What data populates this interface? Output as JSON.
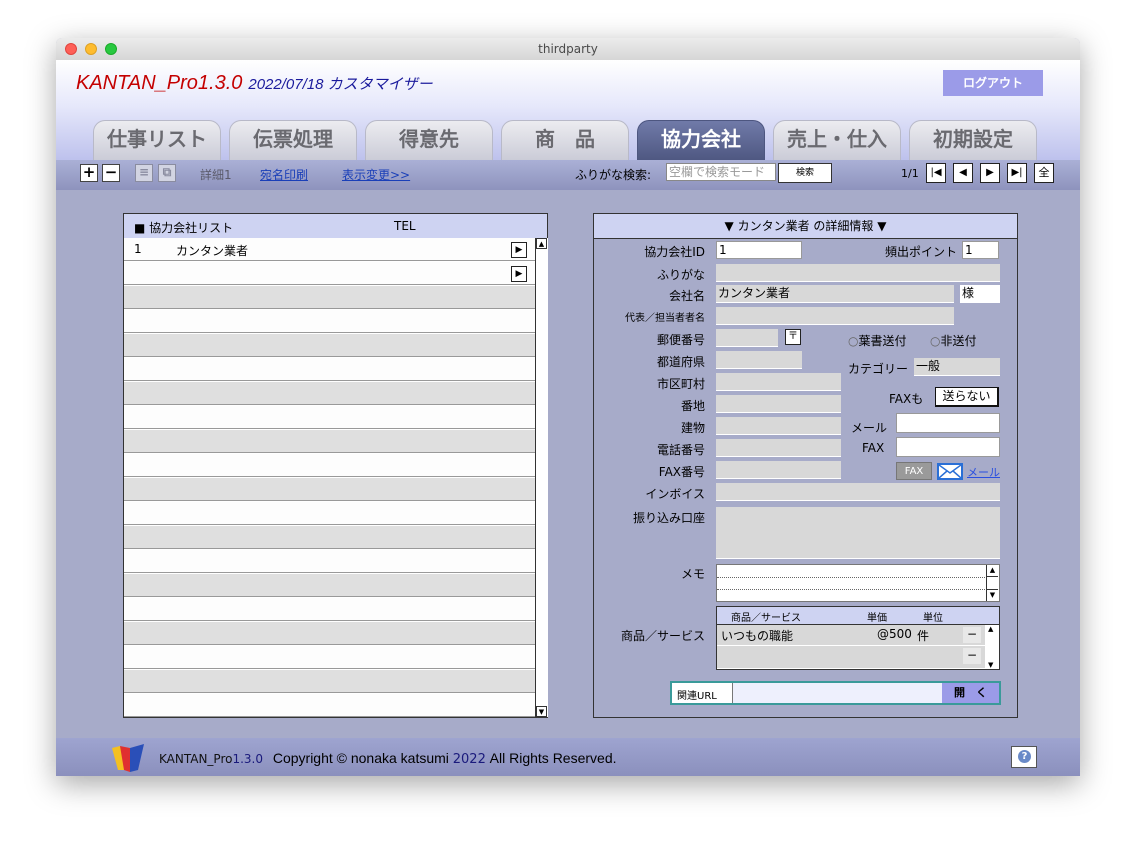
{
  "window": {
    "title": "thirdparty"
  },
  "app": {
    "name": "KANTAN_Pro",
    "version": "1.3.0",
    "subtitle": "2022/07/18 カスタマイザー",
    "logout_label": "ログアウト"
  },
  "tabs": [
    {
      "label": "仕事リスト",
      "active": false
    },
    {
      "label": "伝票処理",
      "active": false
    },
    {
      "label": "得意先",
      "active": false
    },
    {
      "label": "商　品",
      "active": false
    },
    {
      "label": "協力会社",
      "active": true
    },
    {
      "label": "売上・仕入",
      "active": false
    },
    {
      "label": "初期設定",
      "active": false
    }
  ],
  "toolbar": {
    "add": "+",
    "remove": "−",
    "list_icon": "≡",
    "copy_icon": "⧉",
    "detail_label": "詳細1",
    "print_link": "宛名印刷",
    "view_link": "表示変更>>",
    "search_label": "ふりがな検索:",
    "search_placeholder": "空欄で検索モード",
    "search_button": "検索",
    "page": "1/1",
    "nav": {
      "first": "|◀",
      "prev": "◀",
      "next": "▶",
      "last": "▶|",
      "all": "全"
    }
  },
  "list": {
    "header_title": "■ 協力会社リスト",
    "header_tel": "TEL",
    "rows": [
      {
        "no": "1",
        "name": "カンタン業者",
        "tel": ""
      },
      {
        "no": "",
        "name": "",
        "tel": ""
      }
    ],
    "arrow": "▶"
  },
  "detail": {
    "header": "▼ カンタン業者 の詳細情報 ▼",
    "labels": {
      "id": "協力会社ID",
      "hindo": "頻出ポイント",
      "furigana": "ふりがな",
      "company": "会社名",
      "sama": "様",
      "rep": "代表／担当者者名",
      "zip": "郵便番号",
      "zip_btn": "〒",
      "pref": "都道府県",
      "city": "市区町村",
      "banchi": "番地",
      "building": "建物",
      "phone": "電話番号",
      "fax": "FAX番号",
      "invoice": "インボイス",
      "account": "振り込み口座",
      "memo": "メモ",
      "products": "商品／サービス",
      "postcard": "葉書送付",
      "nopost": "非送付",
      "category": "カテゴリー",
      "faxmo": "FAXも",
      "mail": "メール",
      "fax_r": "FAX",
      "fax_btn": "FAX",
      "mail_link": "メール",
      "url": "関連URL",
      "open": "開　く"
    },
    "values": {
      "id": "1",
      "hindo": "1",
      "company": "カンタン業者",
      "category": "一般",
      "fax_send": "送らない"
    },
    "products_table": {
      "headers": [
        "商品／サービス",
        "単価",
        "単位"
      ],
      "rows": [
        {
          "name": "いつもの職能",
          "price": "@500",
          "unit": "件",
          "remove": "−"
        },
        {
          "name": "",
          "price": "",
          "unit": "",
          "remove": "−"
        }
      ]
    }
  },
  "footer": {
    "brand": "KANTAN_Pro",
    "version": "1.3.0",
    "copyright": "Copyright © nonaka katsumi",
    "year": "2022",
    "rights": "All Rights Reserved.",
    "help": "?"
  },
  "colors": {
    "brand_red": "#c40000",
    "active_tab": "#5b6590",
    "logout": "#9b9be8"
  }
}
